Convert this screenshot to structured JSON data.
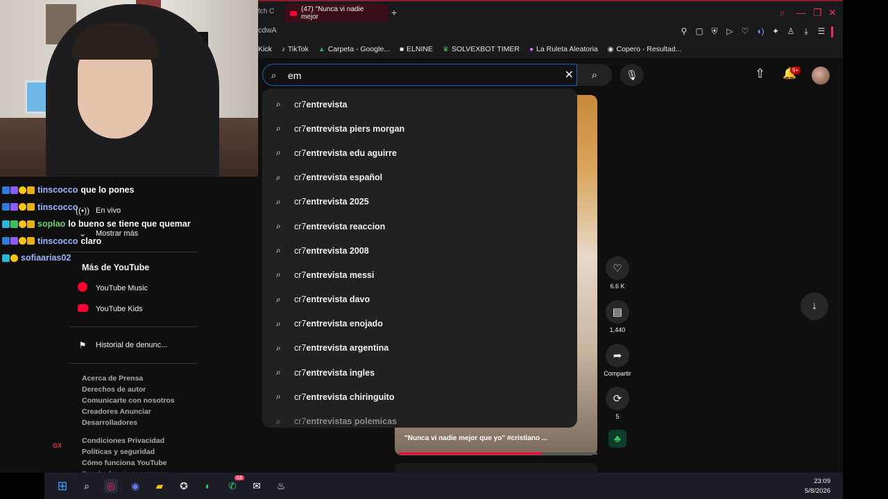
{
  "browser": {
    "prev_tab_label": "tch C",
    "active_tab_label": "(47) \"Nunca vi nadie mejor",
    "new_tab_icon": "plus-icon",
    "address_fragment": "cdwA",
    "accent_color": "#e0364e"
  },
  "bookmarks": [
    {
      "label": "Kick",
      "icon": ""
    },
    {
      "label": "TikTok",
      "icon": "♪"
    },
    {
      "label": "Carpeta - Google...",
      "icon": "▲"
    },
    {
      "label": "ELNINE",
      "icon": "■"
    },
    {
      "label": "SOLVEXBOT TIMER",
      "icon": "♛"
    },
    {
      "label": "La Ruleta Aleatoria",
      "icon": "●"
    },
    {
      "label": "Copero - Resultad...",
      "icon": "◉"
    }
  ],
  "chat": [
    {
      "user": "tinscocco",
      "message": "que lo pones"
    },
    {
      "user": "tinscocco",
      "message": ""
    },
    {
      "user": "soplao",
      "message": "lo bueno se tiene que quemar"
    },
    {
      "user": "tinscocco",
      "message": "claro"
    },
    {
      "user": "sofiaarias02",
      "message": ""
    }
  ],
  "search": {
    "value": "em",
    "suggestion_prefix": "cr7 ",
    "suggestions": [
      "entrevista",
      "entrevista piers morgan",
      "entrevista edu aguirre",
      "entrevista español",
      "entrevista 2025",
      "entrevista reaccion",
      "entrevista 2008",
      "entrevista messi",
      "entrevista davo",
      "entrevista enojado",
      "entrevista argentina",
      "entrevista ingles",
      "entrevista chiringuito",
      "entrevistas polemicas"
    ]
  },
  "header": {
    "notifications_badge": "9+"
  },
  "sidebar": {
    "live_label": "En vivo",
    "show_more": "Mostrar más",
    "more_heading": "Más de YouTube",
    "yt_music": "YouTube Music",
    "yt_kids": "YouTube Kids",
    "report_history": "Historial de denunc...",
    "links1": [
      "Acerca de  Prensa",
      "Derechos de autor",
      "Comunicarte con nosotros",
      "Creadores  Anunciar",
      "Desarrolladores"
    ],
    "links2": [
      "Condiciones  Privacidad",
      "Políticas y seguridad",
      "Cómo funciona YouTube",
      "Prueba funciones nuevas"
    ]
  },
  "short": {
    "title": "\"Nunca vi nadie mejor que yo\" #cristiano ...",
    "progress": 0.72,
    "likes": "6.6 K",
    "comments": "1,440",
    "share": "Compartir",
    "remix": "5"
  },
  "taskbar": {
    "time": "23:09",
    "date": "5/8/2026",
    "whatsapp_badge": "12"
  },
  "opera_gx_label": "GX"
}
